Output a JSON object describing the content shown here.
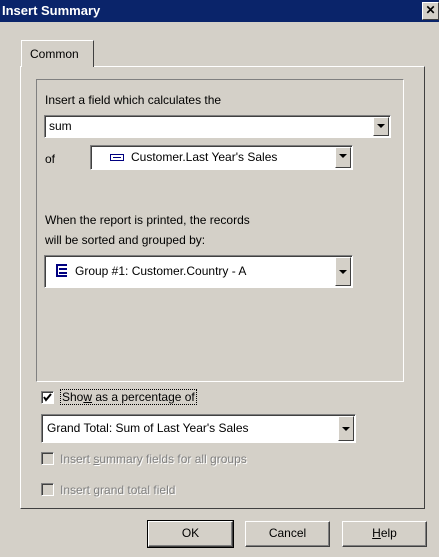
{
  "window": {
    "title": "Insert Summary",
    "close_glyph": "✕"
  },
  "tabs": [
    {
      "label": "Common"
    }
  ],
  "calc": {
    "prompt": "Insert a field which calculates the",
    "function_value": "sum",
    "of_label": "of",
    "field_value": "Customer.Last Year's Sales",
    "field_icon": "field-icon"
  },
  "grouping": {
    "prompt_line1": "When the report is printed, the records",
    "prompt_line2": "will be sorted and grouped by:",
    "group_value": "Group #1: Customer.Country - A",
    "group_icon": "group-icon"
  },
  "percentage": {
    "checked": true,
    "label_pre": "Sho",
    "label_accel": "w",
    "label_post": " as a percentage of",
    "value": "Grand Total: Sum of Last Year's Sales"
  },
  "options": {
    "summary_all_pre": "Insert ",
    "summary_all_accel": "s",
    "summary_all_post": "ummary fields for all groups",
    "grand_total_pre": "Insert ",
    "grand_total_accel": "g",
    "grand_total_post": "rand total field"
  },
  "buttons": {
    "ok": "OK",
    "cancel": "Cancel",
    "help_accel": "H",
    "help_post": "elp"
  },
  "colors": {
    "titlebar": "#0a246a",
    "face": "#d4d0c8",
    "disabled_text": "#808080"
  }
}
